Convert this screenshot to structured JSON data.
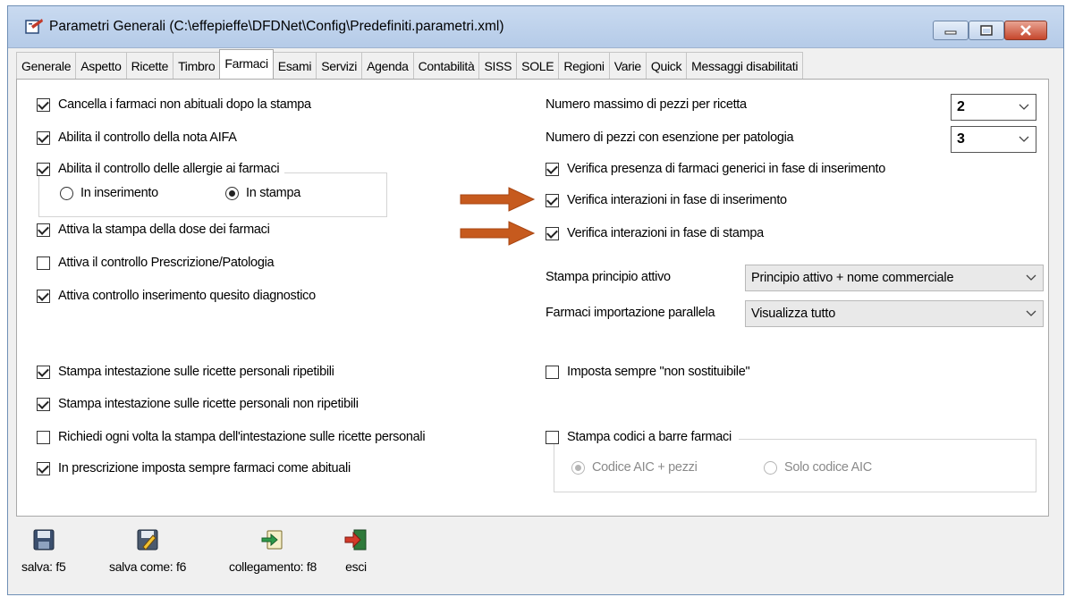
{
  "window": {
    "title": "Parametri Generali (C:\\effepieffe\\DFDNet\\Config\\Predefiniti.parametri.xml)",
    "accent_color": "#c65a1e"
  },
  "tabs": [
    "Generale",
    "Aspetto",
    "Ricette",
    "Timbro",
    "Farmaci",
    "Esami",
    "Servizi",
    "Agenda",
    "Contabilità",
    "SISS",
    "SOLE",
    "Regioni",
    "Varie",
    "Quick",
    "Messaggi disabilitati"
  ],
  "active_tab": "Farmaci",
  "left_options": [
    {
      "label": "Cancella i farmaci non abituali dopo la stampa",
      "checked": true
    },
    {
      "label": "Abilita il controllo della nota AIFA",
      "checked": true
    },
    {
      "label": "Abilita il controllo delle allergie ai farmaci",
      "checked": true
    }
  ],
  "allergy_radios": [
    {
      "label": "In inserimento",
      "checked": false
    },
    {
      "label": "In stampa",
      "checked": true
    }
  ],
  "left_options_2": [
    {
      "label": "Attiva la stampa della dose dei farmaci",
      "checked": true
    },
    {
      "label": "Attiva il controllo Prescrizione/Patologia",
      "checked": false
    },
    {
      "label": "Attiva controllo inserimento quesito diagnostico",
      "checked": true
    }
  ],
  "left_options_3": [
    {
      "label": "Stampa intestazione sulle ricette personali ripetibili",
      "checked": true
    },
    {
      "label": "Stampa intestazione sulle ricette personali non ripetibili",
      "checked": true
    },
    {
      "label": "Richiedi ogni volta la stampa dell'intestazione sulle ricette personali",
      "checked": false
    },
    {
      "label": "In prescrizione imposta sempre farmaci come abituali",
      "checked": true
    }
  ],
  "right_fields": {
    "max_pezzi_label": "Numero massimo di pezzi per ricetta",
    "max_pezzi_value": "2",
    "esenzione_label": "Numero di pezzi con esenzione per patologia",
    "esenzione_value": "3"
  },
  "right_options": [
    {
      "label": "Verifica presenza di farmaci generici in fase di inserimento",
      "checked": true
    },
    {
      "label": "Verifica interazioni in fase di inserimento",
      "checked": true
    },
    {
      "label": "Verifica interazioni in fase di stampa",
      "checked": true
    }
  ],
  "principio": {
    "label": "Stampa principio attivo",
    "value": "Principio attivo + nome commerciale"
  },
  "importazione": {
    "label": "Farmaci importazione parallela",
    "value": "Visualizza tutto"
  },
  "non_sostituibile": {
    "label": "Imposta sempre \"non sostituibile\"",
    "checked": false
  },
  "barcode": {
    "label": "Stampa codici a barre farmaci",
    "checked": false
  },
  "barcode_radios": [
    {
      "label": "Codice AIC + pezzi",
      "checked": true
    },
    {
      "label": "Solo codice AIC",
      "checked": false
    }
  ],
  "toolbar": [
    {
      "label": "salva: f5",
      "icon": "floppy-icon"
    },
    {
      "label": "salva come: f6",
      "icon": "save-as-icon"
    },
    {
      "label": "collegamento: f8",
      "icon": "link-icon"
    },
    {
      "label": "esci",
      "icon": "exit-icon"
    }
  ]
}
